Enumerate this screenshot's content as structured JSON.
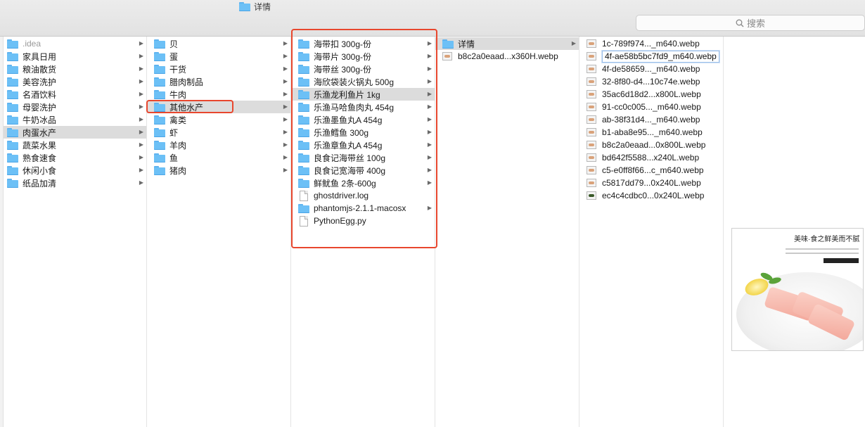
{
  "window": {
    "title": "详情",
    "search_placeholder": "搜索"
  },
  "columns": [
    {
      "items": [
        {
          "label": ".idea",
          "type": "folder",
          "dim": true
        },
        {
          "label": "家具日用",
          "type": "folder"
        },
        {
          "label": "粮油散货",
          "type": "folder"
        },
        {
          "label": "美容洗护",
          "type": "folder"
        },
        {
          "label": "名酒饮料",
          "type": "folder"
        },
        {
          "label": "母婴洗护",
          "type": "folder"
        },
        {
          "label": "牛奶冰品",
          "type": "folder"
        },
        {
          "label": "肉蛋水产",
          "type": "folder",
          "selected": true
        },
        {
          "label": "蔬菜水果",
          "type": "folder"
        },
        {
          "label": "熟食速食",
          "type": "folder"
        },
        {
          "label": "休闲小食",
          "type": "folder"
        },
        {
          "label": "纸品加清",
          "type": "folder"
        }
      ]
    },
    {
      "items": [
        {
          "label": "贝",
          "type": "folder"
        },
        {
          "label": "蛋",
          "type": "folder"
        },
        {
          "label": "干货",
          "type": "folder"
        },
        {
          "label": "腊肉制品",
          "type": "folder"
        },
        {
          "label": "牛肉",
          "type": "folder"
        },
        {
          "label": "其他水产",
          "type": "folder",
          "selected": true
        },
        {
          "label": "禽类",
          "type": "folder"
        },
        {
          "label": "虾",
          "type": "folder"
        },
        {
          "label": "羊肉",
          "type": "folder"
        },
        {
          "label": "鱼",
          "type": "folder"
        },
        {
          "label": "猪肉",
          "type": "folder"
        }
      ]
    },
    {
      "items": [
        {
          "label": "海带扣 300g-份",
          "type": "folder"
        },
        {
          "label": "海带片 300g-份",
          "type": "folder"
        },
        {
          "label": "海带丝 300g-份",
          "type": "folder"
        },
        {
          "label": "海欣袋装火锅丸 500g",
          "type": "folder"
        },
        {
          "label": "乐渔龙利鱼片 1kg",
          "type": "folder",
          "selected": true
        },
        {
          "label": "乐渔马哈鱼肉丸 454g",
          "type": "folder"
        },
        {
          "label": "乐渔墨鱼丸A 454g",
          "type": "folder"
        },
        {
          "label": "乐渔鳕鱼 300g",
          "type": "folder"
        },
        {
          "label": "乐渔章鱼丸A 454g",
          "type": "folder"
        },
        {
          "label": "良食记海带丝 100g",
          "type": "folder"
        },
        {
          "label": "良食记宽海带 400g",
          "type": "folder"
        },
        {
          "label": "鲜鱿鱼 2条-600g",
          "type": "folder"
        },
        {
          "label": "ghostdriver.log",
          "type": "doc"
        },
        {
          "label": "phantomjs-2.1.1-macosx",
          "type": "folder"
        },
        {
          "label": "PythonEgg.py",
          "type": "doc"
        }
      ]
    },
    {
      "items": [
        {
          "label": "详情",
          "type": "folder",
          "selected": true
        },
        {
          "label": "b8c2a0eaad...x360H.webp",
          "type": "image"
        }
      ]
    },
    {
      "items": [
        {
          "label": "1c-789f974..._m640.webp",
          "type": "image"
        },
        {
          "label": "4f-ae58b5bc7fd9_m640.webp",
          "type": "image",
          "editing": true
        },
        {
          "label": "4f-de58659..._m640.webp",
          "type": "image"
        },
        {
          "label": "32-8f80-d4...10c74e.webp",
          "type": "image"
        },
        {
          "label": "35ac6d18d2...x800L.webp",
          "type": "image"
        },
        {
          "label": "91-cc0c005..._m640.webp",
          "type": "image"
        },
        {
          "label": "ab-38f31d4..._m640.webp",
          "type": "image"
        },
        {
          "label": "b1-aba8e95..._m640.webp",
          "type": "image"
        },
        {
          "label": "b8c2a0eaad...0x800L.webp",
          "type": "image"
        },
        {
          "label": "bd642f5588...x240L.webp",
          "type": "image"
        },
        {
          "label": "c5-e0ff8f66...c_m640.webp",
          "type": "image"
        },
        {
          "label": "c5817dd79...0x240L.webp",
          "type": "image"
        },
        {
          "label": "ec4c4cdbc0...0x240L.webp",
          "type": "image",
          "dark": true
        }
      ]
    }
  ],
  "preview": {
    "title": "美味·食之鲜美而不腻"
  },
  "colors": {
    "annotation_red": "#e8472e",
    "folder_blue": "#6cc0f6",
    "selection_gray": "#dcdcdc",
    "selection_blue": "#1d63d6"
  }
}
